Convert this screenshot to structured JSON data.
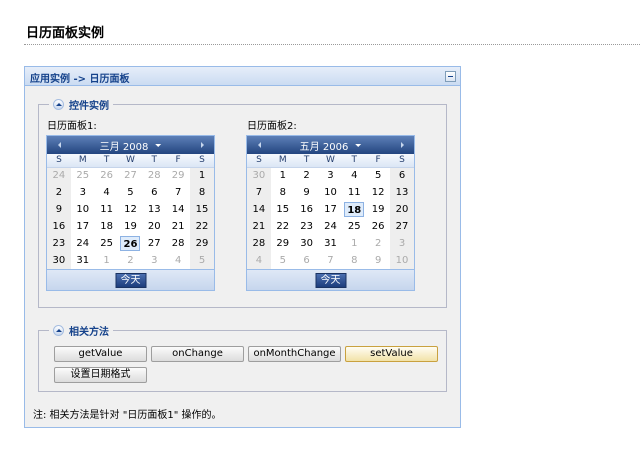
{
  "page": {
    "title": "日历面板实例"
  },
  "panel": {
    "title": "应用实例 -> 日历面板"
  },
  "fieldset_examples": {
    "legend": "控件实例"
  },
  "fieldset_methods": {
    "legend": "相关方法"
  },
  "weekdays": [
    "S",
    "M",
    "T",
    "W",
    "T",
    "F",
    "S"
  ],
  "calendar1": {
    "label": "日历面板1:",
    "month_label": "三月 2008",
    "today_label": "今天",
    "selected_day": 26,
    "weeks": [
      [
        {
          "d": "24",
          "o": 1
        },
        {
          "d": "25",
          "o": 1
        },
        {
          "d": "26",
          "o": 1
        },
        {
          "d": "27",
          "o": 1
        },
        {
          "d": "28",
          "o": 1
        },
        {
          "d": "29",
          "o": 1
        },
        {
          "d": "1",
          "o": 0
        }
      ],
      [
        {
          "d": "2",
          "o": 0
        },
        {
          "d": "3",
          "o": 0
        },
        {
          "d": "4",
          "o": 0
        },
        {
          "d": "5",
          "o": 0
        },
        {
          "d": "6",
          "o": 0
        },
        {
          "d": "7",
          "o": 0
        },
        {
          "d": "8",
          "o": 0
        }
      ],
      [
        {
          "d": "9",
          "o": 0
        },
        {
          "d": "10",
          "o": 0
        },
        {
          "d": "11",
          "o": 0
        },
        {
          "d": "12",
          "o": 0
        },
        {
          "d": "13",
          "o": 0
        },
        {
          "d": "14",
          "o": 0
        },
        {
          "d": "15",
          "o": 0
        }
      ],
      [
        {
          "d": "16",
          "o": 0
        },
        {
          "d": "17",
          "o": 0
        },
        {
          "d": "18",
          "o": 0
        },
        {
          "d": "19",
          "o": 0
        },
        {
          "d": "20",
          "o": 0
        },
        {
          "d": "21",
          "o": 0
        },
        {
          "d": "22",
          "o": 0
        }
      ],
      [
        {
          "d": "23",
          "o": 0
        },
        {
          "d": "24",
          "o": 0
        },
        {
          "d": "25",
          "o": 0
        },
        {
          "d": "26",
          "o": 0
        },
        {
          "d": "27",
          "o": 0
        },
        {
          "d": "28",
          "o": 0
        },
        {
          "d": "29",
          "o": 0
        }
      ],
      [
        {
          "d": "30",
          "o": 0
        },
        {
          "d": "31",
          "o": 0
        },
        {
          "d": "1",
          "o": 1
        },
        {
          "d": "2",
          "o": 1
        },
        {
          "d": "3",
          "o": 1
        },
        {
          "d": "4",
          "o": 1
        },
        {
          "d": "5",
          "o": 1
        }
      ]
    ]
  },
  "calendar2": {
    "label": "日历面板2:",
    "month_label": "五月 2006",
    "today_label": "今天",
    "selected_day": 18,
    "weeks": [
      [
        {
          "d": "30",
          "o": 1
        },
        {
          "d": "1",
          "o": 0
        },
        {
          "d": "2",
          "o": 0
        },
        {
          "d": "3",
          "o": 0
        },
        {
          "d": "4",
          "o": 0
        },
        {
          "d": "5",
          "o": 0
        },
        {
          "d": "6",
          "o": 0
        }
      ],
      [
        {
          "d": "7",
          "o": 0
        },
        {
          "d": "8",
          "o": 0
        },
        {
          "d": "9",
          "o": 0
        },
        {
          "d": "10",
          "o": 0
        },
        {
          "d": "11",
          "o": 0
        },
        {
          "d": "12",
          "o": 0
        },
        {
          "d": "13",
          "o": 0
        }
      ],
      [
        {
          "d": "14",
          "o": 0
        },
        {
          "d": "15",
          "o": 0
        },
        {
          "d": "16",
          "o": 0
        },
        {
          "d": "17",
          "o": 0
        },
        {
          "d": "18",
          "o": 0
        },
        {
          "d": "19",
          "o": 0
        },
        {
          "d": "20",
          "o": 0
        }
      ],
      [
        {
          "d": "21",
          "o": 0
        },
        {
          "d": "22",
          "o": 0
        },
        {
          "d": "23",
          "o": 0
        },
        {
          "d": "24",
          "o": 0
        },
        {
          "d": "25",
          "o": 0
        },
        {
          "d": "26",
          "o": 0
        },
        {
          "d": "27",
          "o": 0
        }
      ],
      [
        {
          "d": "28",
          "o": 0
        },
        {
          "d": "29",
          "o": 0
        },
        {
          "d": "30",
          "o": 0
        },
        {
          "d": "31",
          "o": 0
        },
        {
          "d": "1",
          "o": 1
        },
        {
          "d": "2",
          "o": 1
        },
        {
          "d": "3",
          "o": 1
        }
      ],
      [
        {
          "d": "4",
          "o": 1
        },
        {
          "d": "5",
          "o": 1
        },
        {
          "d": "6",
          "o": 1
        },
        {
          "d": "7",
          "o": 1
        },
        {
          "d": "8",
          "o": 1
        },
        {
          "d": "9",
          "o": 1
        },
        {
          "d": "10",
          "o": 1
        }
      ]
    ]
  },
  "methods": {
    "get_value": "getValue",
    "on_change": "onChange",
    "on_month_change": "onMonthChange",
    "set_value": "setValue",
    "set_format": "设置日期格式"
  },
  "note": "注: 相关方法是针对 \"日历面板1\" 操作的。",
  "colors": {
    "accent": "#15428b",
    "header_blue": "#23457f",
    "panel_border": "#99bbe8",
    "focused_button": "#f2e2a8"
  }
}
